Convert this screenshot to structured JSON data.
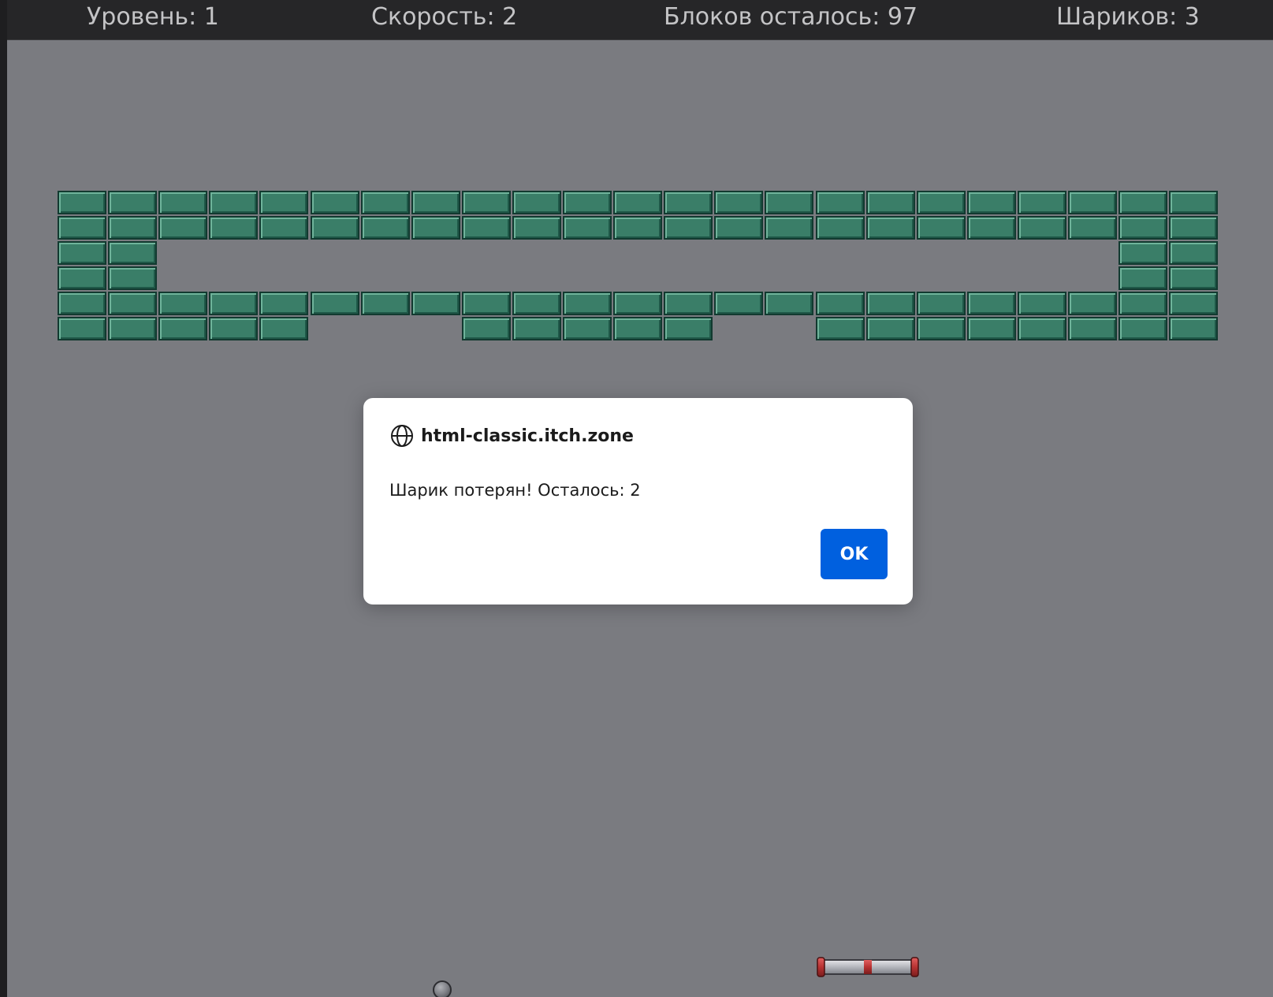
{
  "hud": {
    "level": "Уровень: 1",
    "speed": "Скорость: 2",
    "blocks_left": "Блоков осталось: 97",
    "balls": "Шариков: 3"
  },
  "bricks": {
    "columns": 23,
    "rows": [
      "11111111111111111111111",
      "11111111111111111111111",
      "11000000000000000000011",
      "11000000000000000000011",
      "11111111111111111111111",
      "11111000111110011111111"
    ],
    "colors": {
      "fill": "#3a7e68",
      "border": "#123a30",
      "highlight": "#6fb49b",
      "shade": "#1f5848"
    }
  },
  "dialog": {
    "origin": "html-classic.itch.zone",
    "message": "Шарик потерян! Осталось: 2",
    "ok_label": "OK",
    "icon": "globe-icon",
    "button_color": "#0060df"
  },
  "colors": {
    "field": "#7a7b80",
    "hud_bg": "#262628",
    "hud_text": "#c4c4c6"
  }
}
